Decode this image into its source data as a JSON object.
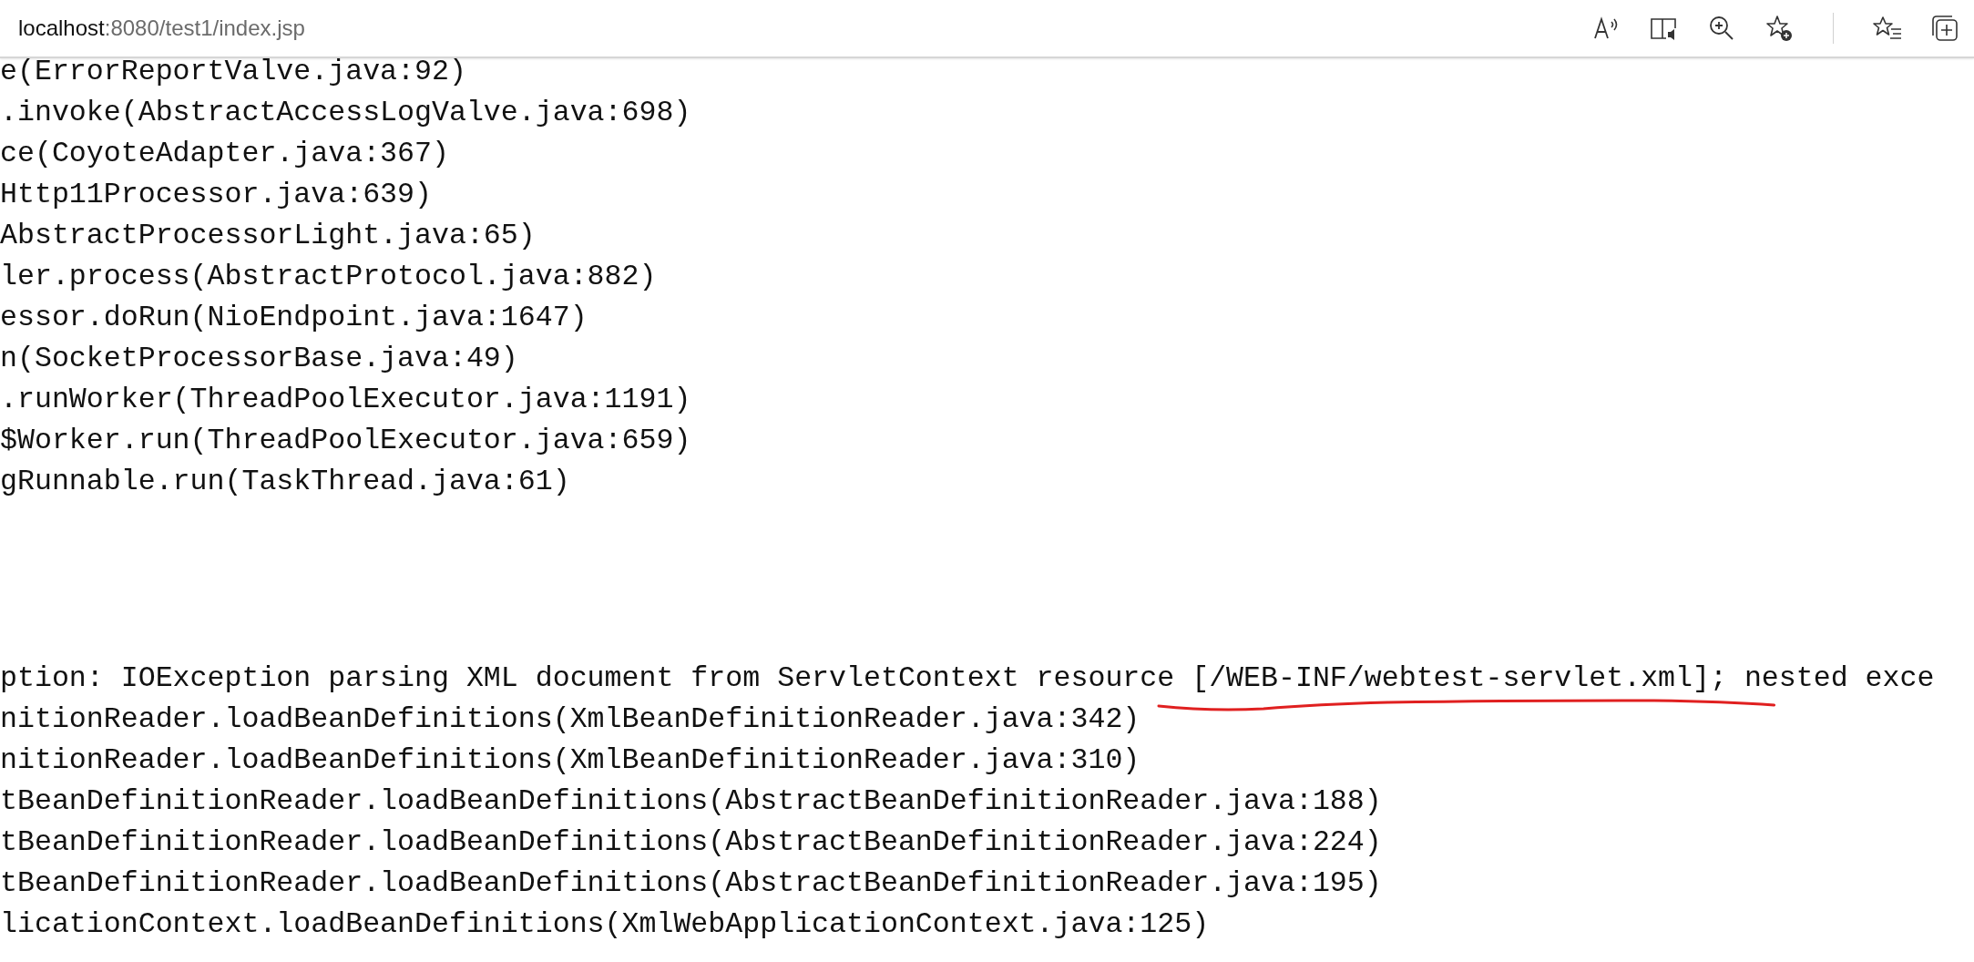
{
  "address_bar": {
    "host": "localhost",
    "path": ":8080/test1/index.jsp"
  },
  "toolbar_icons": [
    {
      "kind": "read-aloud"
    },
    {
      "kind": "reader"
    },
    {
      "kind": "zoom"
    },
    {
      "kind": "favorite-add"
    },
    {
      "kind": "separator"
    },
    {
      "kind": "favorites"
    },
    {
      "kind": "collections"
    }
  ],
  "log_blocks": [
    {
      "lines": [
        "e(ErrorReportValve.java:92)",
        ".invoke(AbstractAccessLogValve.java:698)",
        "ce(CoyoteAdapter.java:367)",
        "Http11Processor.java:639)",
        "AbstractProcessorLight.java:65)",
        "ler.process(AbstractProtocol.java:882)",
        "essor.doRun(NioEndpoint.java:1647)",
        "n(SocketProcessorBase.java:49)",
        ".runWorker(ThreadPoolExecutor.java:1191)",
        "$Worker.run(ThreadPoolExecutor.java:659)",
        "gRunnable.run(TaskThread.java:61)"
      ]
    },
    {
      "lines": [
        "ption: IOException parsing XML document from ServletContext resource [/WEB-INF/webtest-servlet.xml]; nested exce",
        "nitionReader.loadBeanDefinitions(XmlBeanDefinitionReader.java:342)",
        "nitionReader.loadBeanDefinitions(XmlBeanDefinitionReader.java:310)",
        "tBeanDefinitionReader.loadBeanDefinitions(AbstractBeanDefinitionReader.java:188)",
        "tBeanDefinitionReader.loadBeanDefinitions(AbstractBeanDefinitionReader.java:224)",
        "tBeanDefinitionReader.loadBeanDefinitions(AbstractBeanDefinitionReader.java:195)",
        "licationContext.loadBeanDefinitions(XmlWebApplicationContext.java:125)"
      ],
      "underline_first_line": true
    }
  ]
}
